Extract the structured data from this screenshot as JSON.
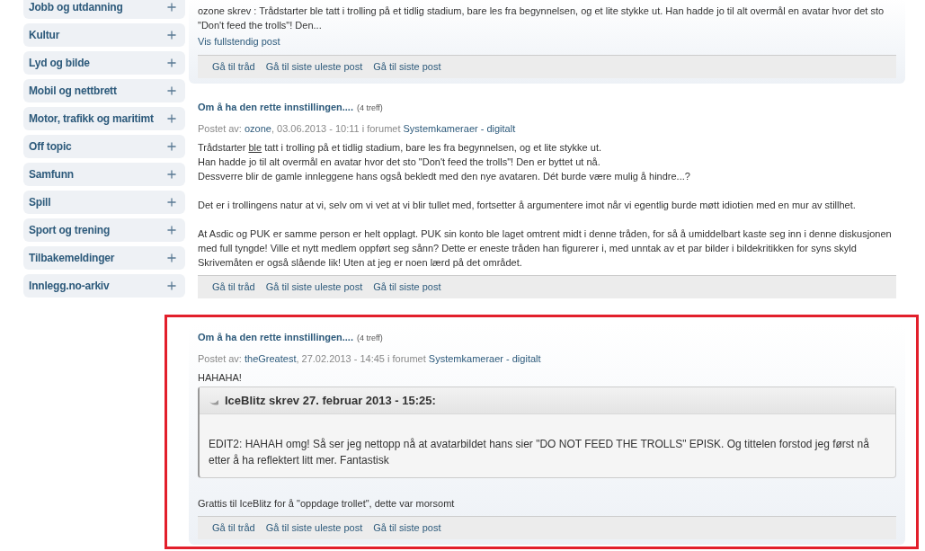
{
  "sidebar": {
    "items": [
      {
        "label": "Jobb og utdanning",
        "expanded": false
      },
      {
        "label": "Kultur",
        "expanded": false
      },
      {
        "label": "Lyd og bilde",
        "expanded": false
      },
      {
        "label": "Mobil og nettbrett",
        "expanded": false
      },
      {
        "label": "Motor, trafikk og maritimt",
        "expanded": false
      },
      {
        "label": "Off topic",
        "expanded": false
      },
      {
        "label": "Samfunn",
        "expanded": false
      },
      {
        "label": "Spill",
        "expanded": false
      },
      {
        "label": "Sport og trening",
        "expanded": false
      },
      {
        "label": "Tilbakemeldinger",
        "expanded": false
      },
      {
        "label": "Innlegg.no-arkiv",
        "expanded": false
      }
    ]
  },
  "posts": [
    {
      "highlighted": false,
      "carded": true,
      "paragraphs": [
        [
          [
            {
              "text": "ozone skrev : Trådstarter ble tatt i trolling på et tidlig stadium, bare les fra begynnelsen, og et lite stykke ut. Han hadde jo til alt overmål en avatar hvor det sto \"Don't feed the trolls\"! Den...",
              "underline": false
            }
          ]
        ]
      ],
      "more_link": "Vis fullstendig post",
      "actions": [
        "Gå til tråd",
        "Gå til siste uleste post",
        "Gå til siste post"
      ]
    },
    {
      "highlighted": false,
      "carded": false,
      "title": "Om å ha den rette innstillingen....",
      "hits": "(4 treff)",
      "meta": {
        "prefix": "Postet av:",
        "author": "ozone",
        "date": ", 03.06.2013 - 10:11 i forumet",
        "forum": "Systemkameraer - digitalt"
      },
      "paragraphs": [
        [
          [
            {
              "text": "Trådstarter ",
              "underline": false
            },
            {
              "text": "ble",
              "underline": true
            },
            {
              "text": " tatt i trolling på et tidlig stadium, bare les fra begynnelsen, og et lite stykke ut.",
              "underline": false
            }
          ],
          [
            {
              "text": "Han hadde jo til alt overmål en avatar hvor det sto \"Don't feed the trolls\"! Den er byttet ut nå.",
              "underline": false
            }
          ],
          [
            {
              "text": "Dessverre blir de gamle innleggene hans også bekledt med den nye avataren. Dét burde være mulig å hindre...?",
              "underline": false
            }
          ]
        ],
        [
          [
            {
              "text": "Det er i trollingens natur at vi, selv om vi vet at vi blir tullet med, fortsetter å argumentere imot når vi egentlig burde møtt idiotien med en mur av stillhet.",
              "underline": false
            }
          ]
        ],
        [
          [
            {
              "text": "At Asdic og PUK er samme person er helt opplagt. PUK sin konto ble laget omtrent midt i denne tråden, for så å umiddelbart kaste seg inn i denne diskusjonen med full tyngde! Ville et nytt medlem oppført seg sånn? Dette er eneste tråden han figurerer i, med unntak av et par bilder i bildekritikken for syns skyld",
              "underline": false
            }
          ],
          [
            {
              "text": "Skrivemåten er også slående lik! Uten at jeg er noen lærd på det området.",
              "underline": false
            }
          ]
        ]
      ],
      "actions": [
        "Gå til tråd",
        "Gå til siste uleste post",
        "Gå til siste post"
      ]
    },
    {
      "highlighted": true,
      "carded": true,
      "title": "Om å ha den rette innstillingen....",
      "hits": "(4 treff)",
      "meta": {
        "prefix": "Postet av:",
        "author": "theGreatest",
        "date": ", 27.02.2013 - 14:45 i forumet",
        "forum": "Systemkameraer - digitalt"
      },
      "intro": "HAHAHA!",
      "quote": {
        "header": "IceBlitz skrev 27. februar 2013 - 15:25:",
        "body": "EDIT2: HAHAH omg! Så ser jeg nettopp nå at avatarbildet hans sier \"DO NOT FEED THE TROLLS\" EPISK. Og tittelen forstod jeg først nå etter å ha reflektert litt mer. Fantastisk"
      },
      "paragraphs": [
        [
          [
            {
              "text": "Grattis til IceBlitz for å \"oppdage trollet\", dette var morsomt",
              "underline": false
            }
          ]
        ]
      ],
      "actions": [
        "Gå til tråd",
        "Gå til siste uleste post",
        "Gå til siste post"
      ]
    }
  ]
}
